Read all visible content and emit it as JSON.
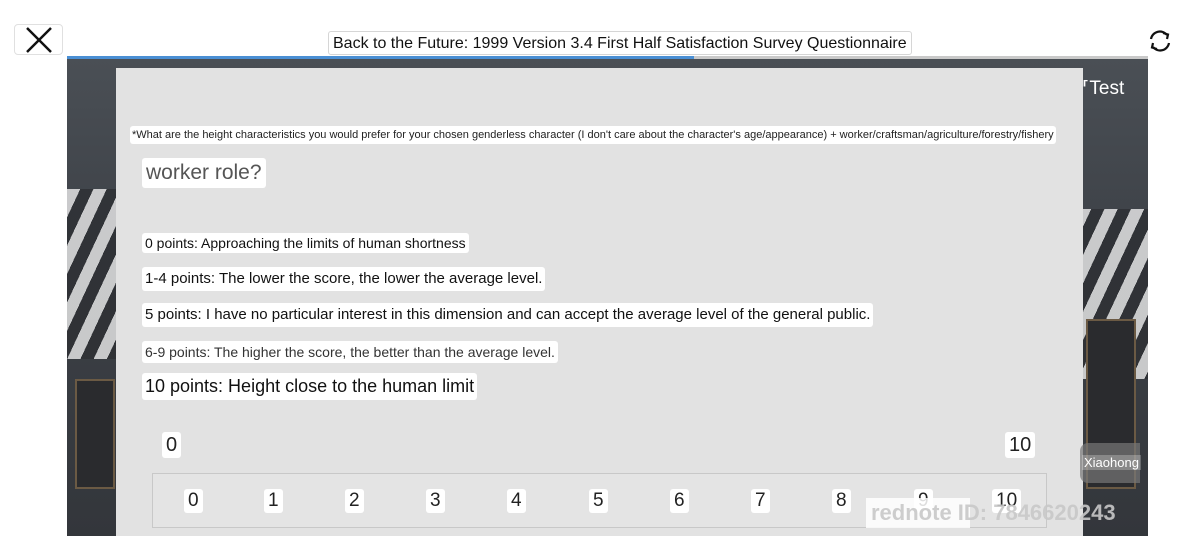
{
  "header": {
    "title": "Back to the Future: 1999 Version 3.4 First Half Satisfaction Survey Questionnaire",
    "progress": 0.58
  },
  "corner_label": "Test",
  "question": {
    "text": "*What are the height characteristics you would prefer for your chosen genderless character (I don't care about the character's age/appearance) + worker/craftsman/agriculture/forestry/fishery",
    "continuation": "worker role?"
  },
  "descriptions": [
    "0 points: Approaching the limits of human shortness",
    "1-4 points: The lower the score, the lower the average level.",
    "5 points: I have no particular interest in this dimension and can accept the average level of the general public.",
    "6-9 points: The higher the score, the better than the average level.",
    "10 points: Height close to the human limit"
  ],
  "scale": {
    "min_label": "0",
    "max_label": "10",
    "options": [
      "0",
      "1",
      "2",
      "3",
      "4",
      "5",
      "6",
      "7",
      "8",
      "9",
      "10"
    ]
  },
  "side_bubble": "Xiaohong",
  "watermark": "rednote ID: 7846620243"
}
